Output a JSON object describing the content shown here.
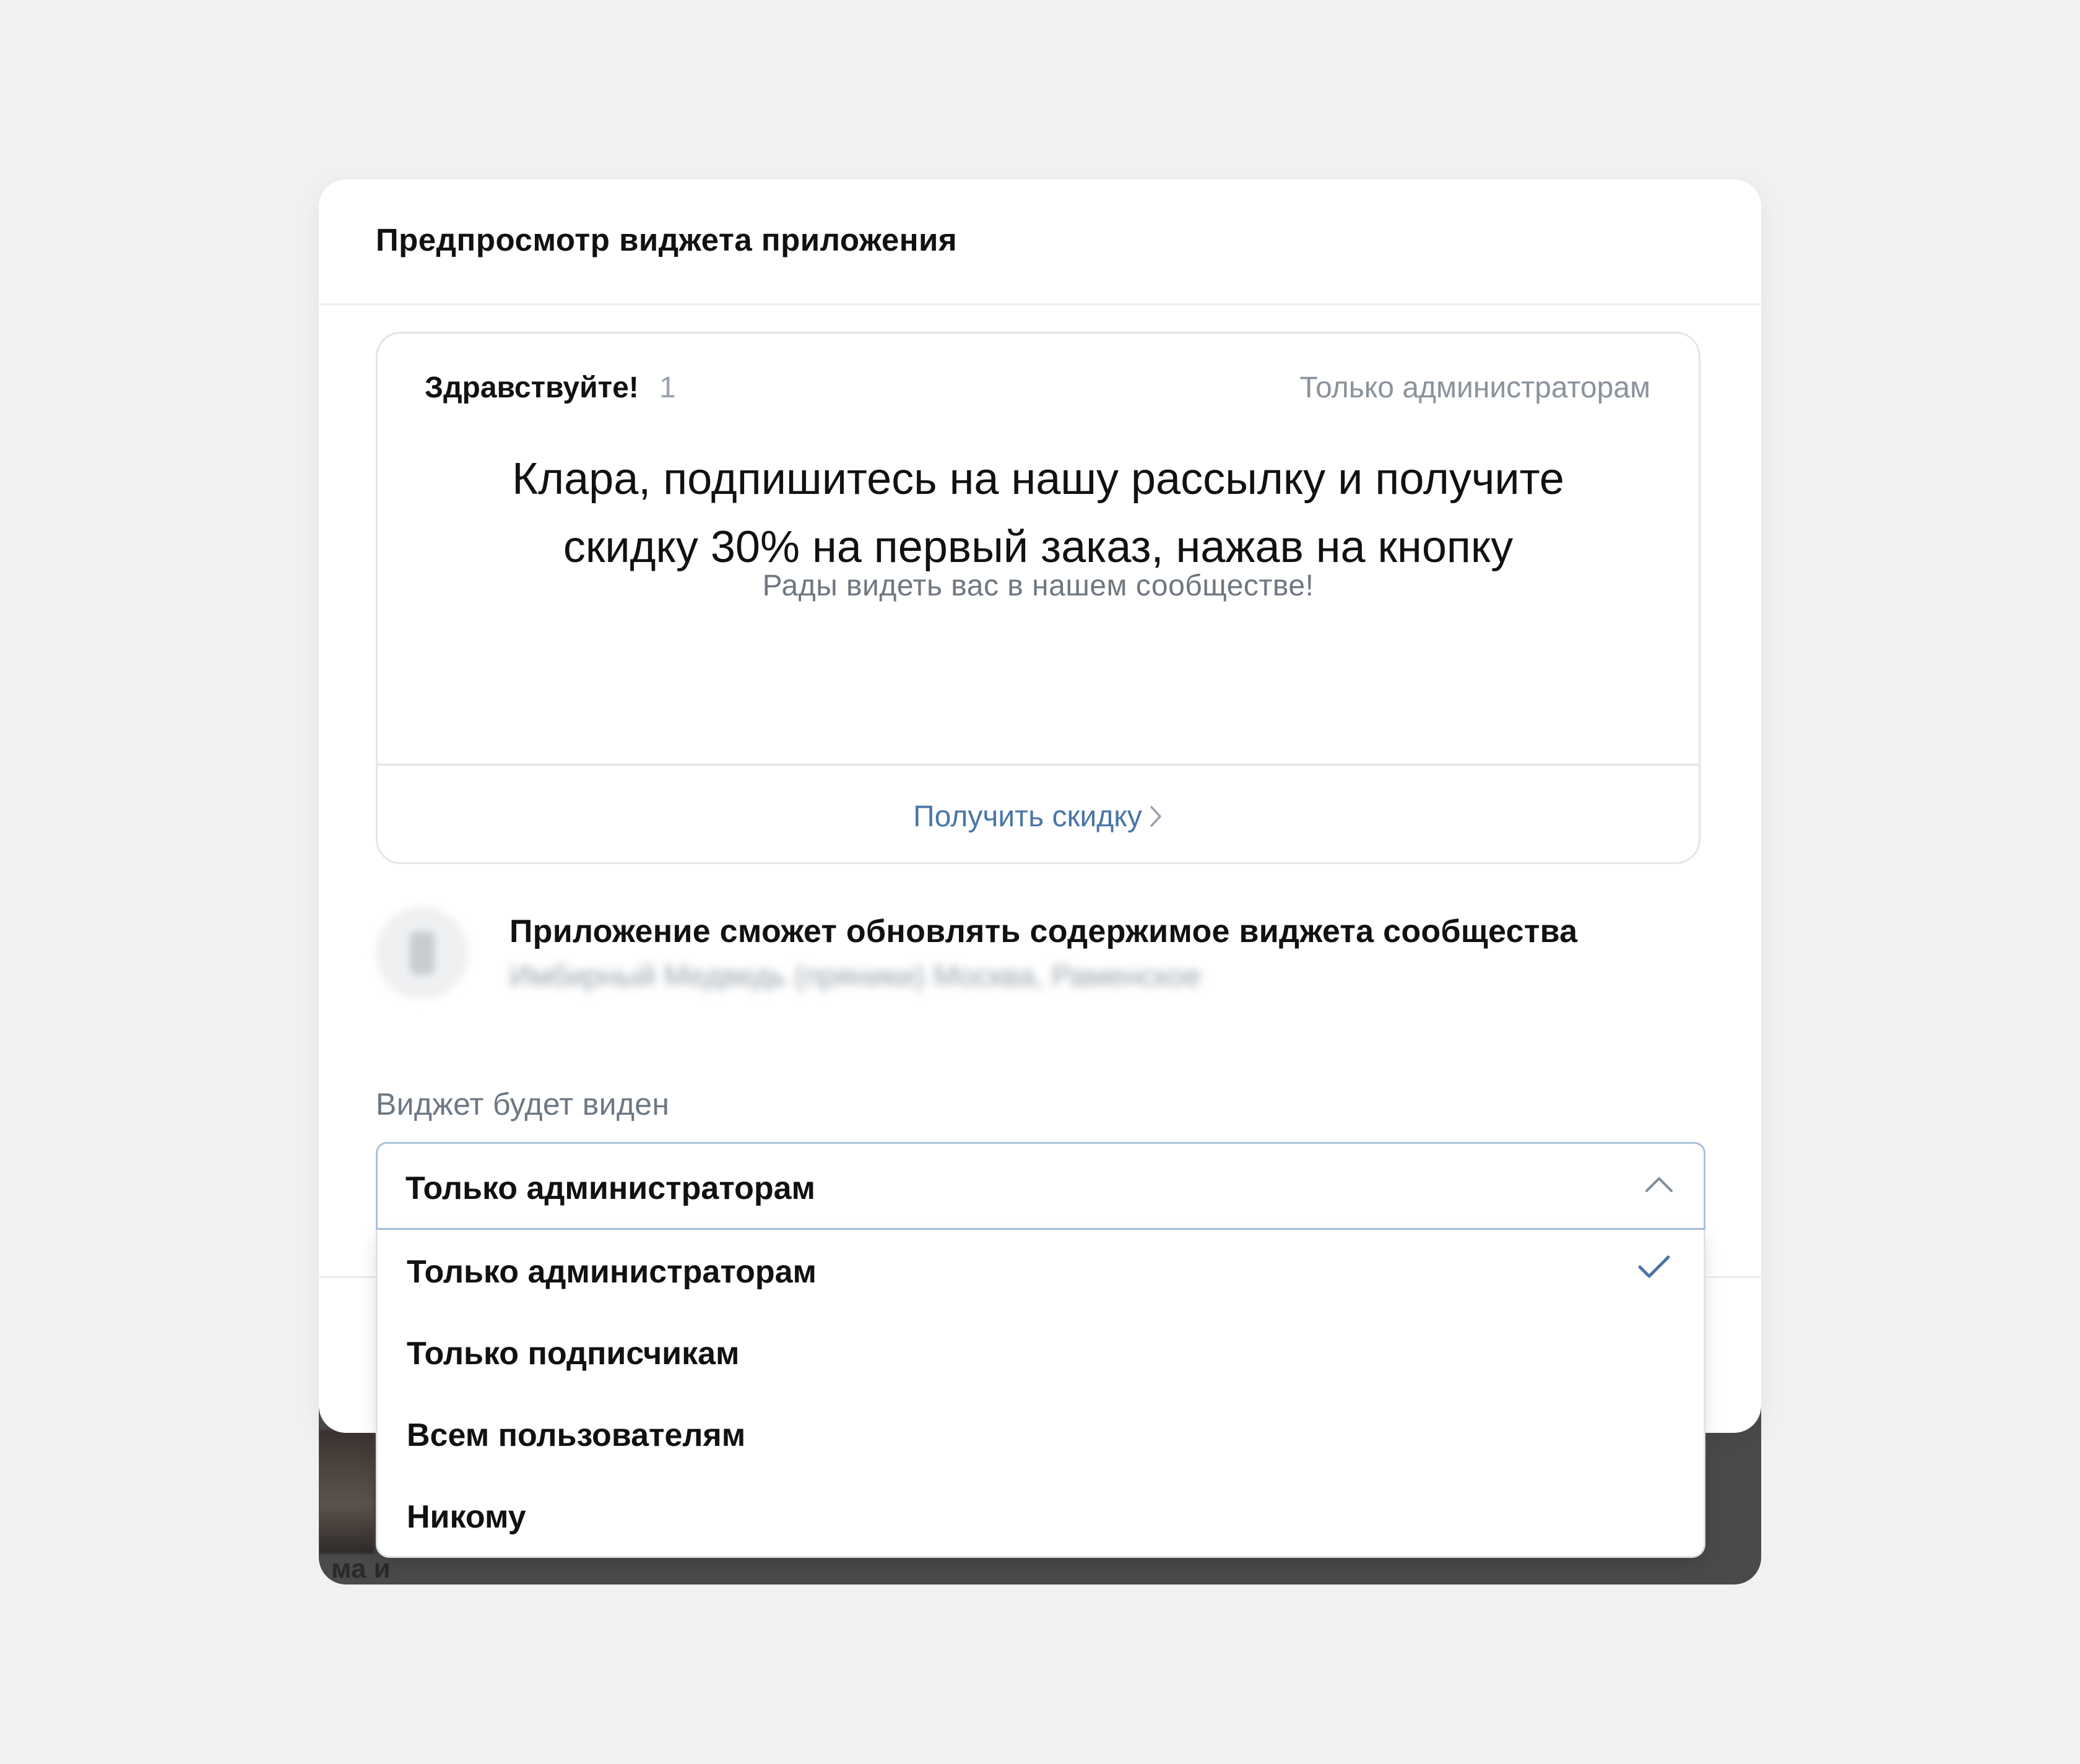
{
  "modal": {
    "title": "Предпросмотр виджета приложения"
  },
  "widget": {
    "greeting": "Здравствуйте!",
    "greeting_count": "1",
    "visibility_label": "Только администраторам",
    "heading_line1": "Клара, подпишитесь на нашу рассылку и получите",
    "heading_line2": "скидку 30% на первый заказ, нажав на кнопку",
    "subtext": "Рады видеть вас в нашем сообществе!",
    "button_label": "Получить скидку"
  },
  "permission": {
    "text": "Приложение сможет обновлять содержимое виджета сообщества",
    "community_name": "Имбирный Медведь (пряники) Москва, Раменское"
  },
  "visibility_field": {
    "label": "Виджет будет виден",
    "selected": "Только администраторам",
    "options": [
      {
        "label": "Только администраторам",
        "checked": true
      },
      {
        "label": "Только подписчикам",
        "checked": false
      },
      {
        "label": "Всем пользователям",
        "checked": false
      },
      {
        "label": "Никому",
        "checked": false
      }
    ]
  },
  "background": {
    "partial_text": "ма и"
  },
  "colors": {
    "page_bg": "#f0f1f3",
    "accent": "#4a76a8",
    "muted_text": "#8a929b",
    "select_border": "#a9c1dc"
  }
}
